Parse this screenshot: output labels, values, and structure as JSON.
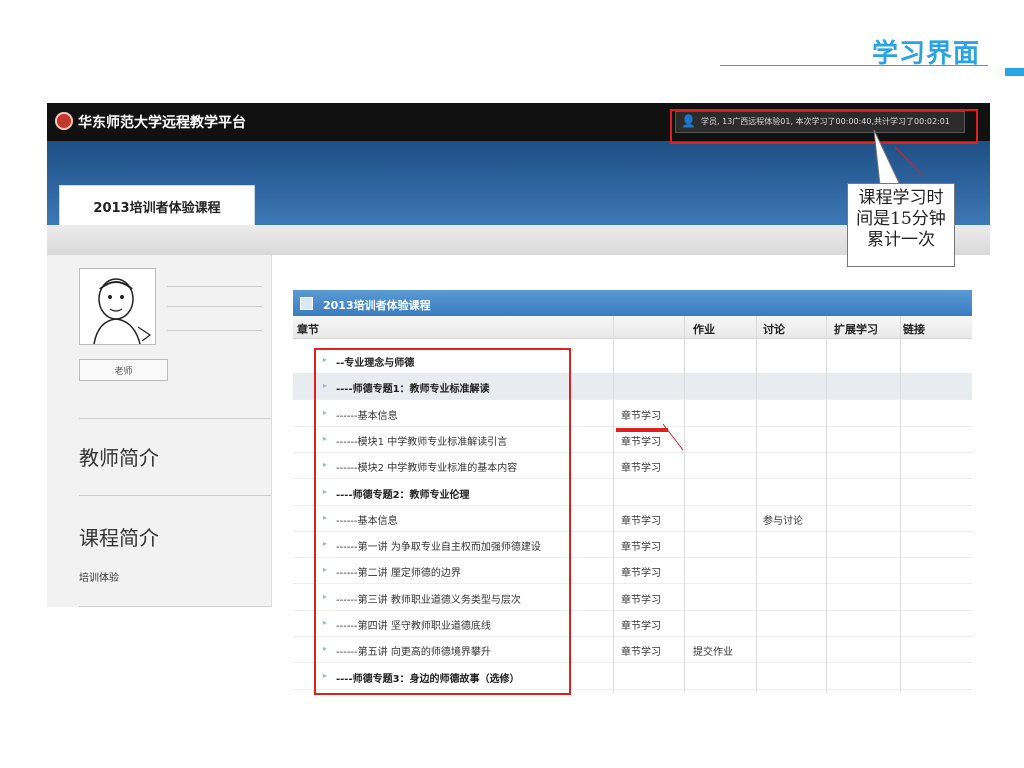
{
  "slide": {
    "title": "学习界面"
  },
  "platform": {
    "brand": "华东师范大学远程教学平台",
    "user_info": "学员, 13广西远程体验01,  本次学习了00:00:40,共计学习了00:02:01"
  },
  "course": {
    "tab_label": "2013培训者体验课程"
  },
  "sidebar": {
    "teacher_label": "老师",
    "teacher_intro_title": "教师简介",
    "course_intro_title": "课程简介",
    "course_intro_text": "培训体验"
  },
  "table": {
    "title": "2013培训者体验课程",
    "columns": [
      "章节",
      "作业",
      "讨论",
      "扩展学习",
      "链接"
    ],
    "rows": [
      {
        "chapter": "--专业理念与师德",
        "bold": true,
        "study": "",
        "homework": "",
        "discussion": ""
      },
      {
        "chapter": "----师德专题1：教师专业标准解读",
        "bold": true,
        "study": "",
        "homework": "",
        "discussion": ""
      },
      {
        "chapter": "------基本信息",
        "bold": false,
        "study": "章节学习",
        "homework": "",
        "discussion": ""
      },
      {
        "chapter": "------模块1 中学教师专业标准解读引言",
        "bold": false,
        "study": "章节学习",
        "homework": "",
        "discussion": ""
      },
      {
        "chapter": "------模块2 中学教师专业标准的基本内容",
        "bold": false,
        "study": "章节学习",
        "homework": "",
        "discussion": ""
      },
      {
        "chapter": "----师德专题2：教师专业伦理",
        "bold": true,
        "study": "",
        "homework": "",
        "discussion": ""
      },
      {
        "chapter": "------基本信息",
        "bold": false,
        "study": "章节学习",
        "homework": "",
        "discussion": "参与讨论"
      },
      {
        "chapter": "------第一讲 为争取专业自主权而加强师德建设",
        "bold": false,
        "study": "章节学习",
        "homework": "",
        "discussion": ""
      },
      {
        "chapter": "------第二讲 厘定师德的边界",
        "bold": false,
        "study": "章节学习",
        "homework": "",
        "discussion": ""
      },
      {
        "chapter": "------第三讲 教师职业道德义务类型与层次",
        "bold": false,
        "study": "章节学习",
        "homework": "",
        "discussion": ""
      },
      {
        "chapter": "------第四讲 坚守教师职业道德底线",
        "bold": false,
        "study": "章节学习",
        "homework": "",
        "discussion": ""
      },
      {
        "chapter": "------第五讲 向更高的师德境界攀升",
        "bold": false,
        "study": "章节学习",
        "homework": "提交作业",
        "discussion": ""
      },
      {
        "chapter": "----师德专题3：身边的师德故事（选修）",
        "bold": true,
        "study": "",
        "homework": "",
        "discussion": ""
      }
    ]
  },
  "callout": {
    "lines": [
      "课程学习时",
      "间是15分钟",
      "累计一次"
    ]
  },
  "colors": {
    "accent": "#29a3e3",
    "annotation_red": "#e01f1f",
    "banner_blue": "#2f66a3"
  }
}
